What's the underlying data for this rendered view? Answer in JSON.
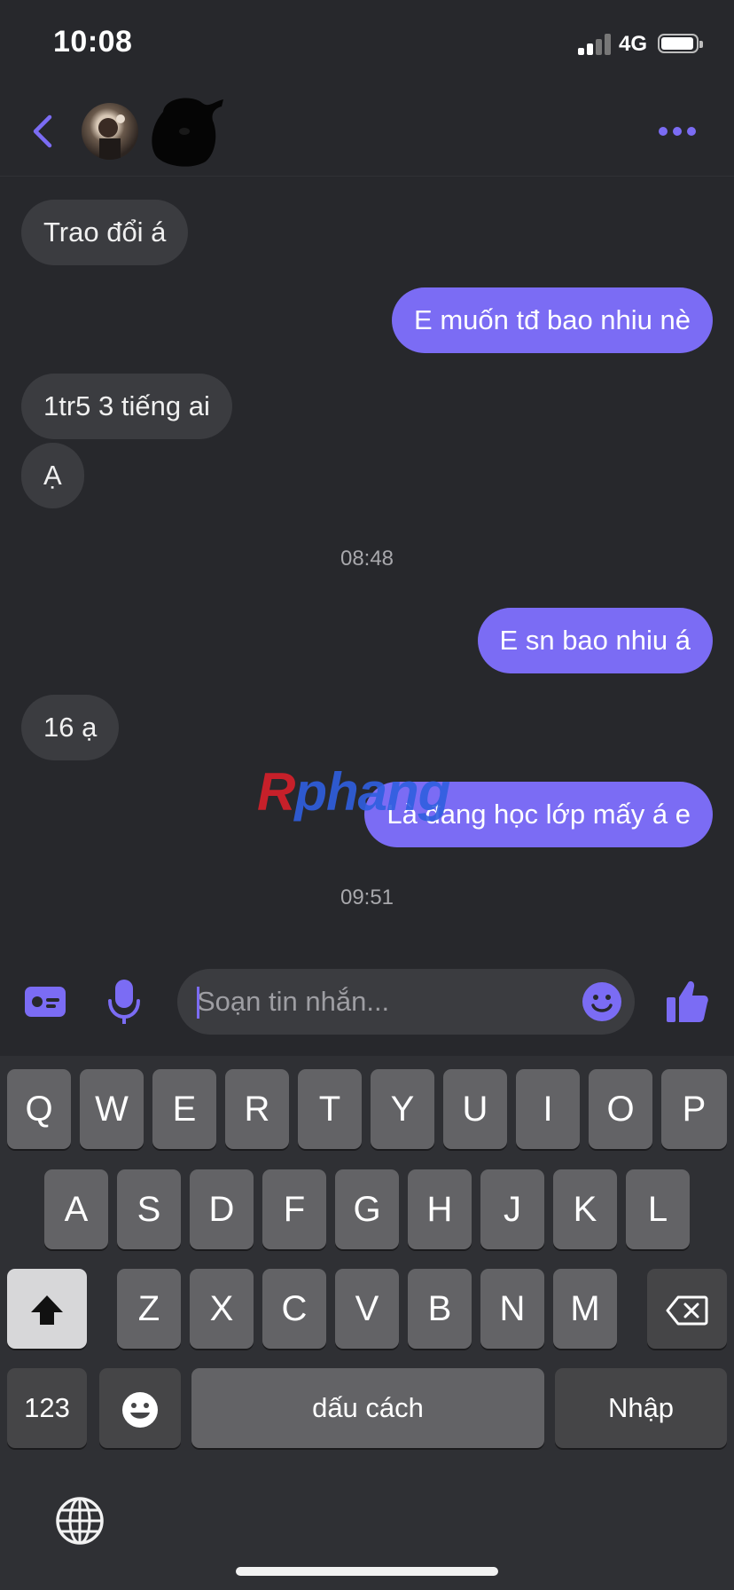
{
  "status_bar": {
    "time": "10:08",
    "network": "4G"
  },
  "header": {
    "back_icon": "chevron-left-icon",
    "more_icon": "ellipsis-icon"
  },
  "messages": [
    {
      "from": "them",
      "text": "Trao đổi á"
    },
    {
      "from": "me",
      "text": "E muốn tđ bao nhiu nè"
    },
    {
      "from": "them",
      "text": "1tr5 3 tiếng ai"
    },
    {
      "from": "them",
      "text": "Ạ"
    },
    {
      "timestamp": "08:48"
    },
    {
      "from": "me",
      "text": "E sn bao nhiu á"
    },
    {
      "from": "them",
      "text": "16 ạ"
    },
    {
      "from": "me",
      "text": "Là đang học lớp mấy á e"
    },
    {
      "timestamp": "09:51"
    }
  ],
  "watermark": {
    "part1": "R",
    "part2": "phang"
  },
  "composer": {
    "placeholder": "Soạn tin nhắn...",
    "icons": [
      "contact-card-icon",
      "microphone-icon",
      "emoji-icon",
      "thumbs-up-icon"
    ]
  },
  "keyboard": {
    "row1": [
      "Q",
      "W",
      "E",
      "R",
      "T",
      "Y",
      "U",
      "I",
      "O",
      "P"
    ],
    "row2": [
      "A",
      "S",
      "D",
      "F",
      "G",
      "H",
      "J",
      "K",
      "L"
    ],
    "row3": [
      "Z",
      "X",
      "C",
      "V",
      "B",
      "N",
      "M"
    ],
    "numbers_label": "123",
    "space_label": "dấu cách",
    "return_label": "Nhập",
    "shift_icon": "shift-icon",
    "delete_icon": "backspace-icon",
    "emoji_icon": "emoji-icon",
    "globe_icon": "globe-icon"
  },
  "colors": {
    "accent": "#7b6cf4",
    "background": "#27282c",
    "incoming_bubble": "#3b3c40",
    "keyboard_bg": "#2f3034",
    "key": "#636366"
  }
}
